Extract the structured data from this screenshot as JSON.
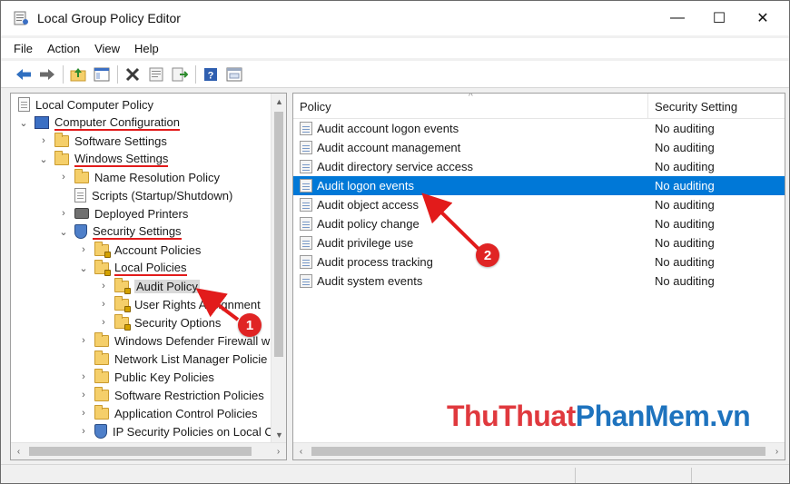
{
  "window": {
    "title": "Local Group Policy Editor",
    "controls": {
      "minimize": "—",
      "maximize": "☐",
      "close": "✕"
    }
  },
  "menu": [
    "File",
    "Action",
    "View",
    "Help"
  ],
  "toolbar": [
    "back-icon",
    "forward-icon",
    "up-folder-icon",
    "show-hide-tree-icon",
    "delete-icon",
    "properties-icon",
    "export-icon",
    "help-icon",
    "view-icon"
  ],
  "tree": {
    "root": "Local Computer Policy",
    "computer_configuration": "Computer Configuration",
    "software_settings": "Software Settings",
    "windows_settings": "Windows Settings",
    "name_resolution_policy": "Name Resolution Policy",
    "scripts": "Scripts (Startup/Shutdown)",
    "deployed_printers": "Deployed Printers",
    "security_settings": "Security Settings",
    "account_policies": "Account Policies",
    "local_policies": "Local Policies",
    "audit_policy": "Audit Policy",
    "user_rights_assignment": "User Rights Assignment",
    "security_options": "Security Options",
    "windows_defender_firewall": "Windows Defender Firewall w",
    "network_list_manager": "Network List Manager Policie",
    "public_key_policies": "Public Key Policies",
    "software_restriction": "Software Restriction Policies",
    "application_control": "Application Control Policies",
    "ip_security": "IP Security Policies on Local C"
  },
  "list": {
    "columns": [
      "Policy",
      "Security Setting"
    ],
    "rows": [
      {
        "policy": "Audit account logon events",
        "setting": "No auditing"
      },
      {
        "policy": "Audit account management",
        "setting": "No auditing"
      },
      {
        "policy": "Audit directory service access",
        "setting": "No auditing"
      },
      {
        "policy": "Audit logon events",
        "setting": "No auditing",
        "selected": true
      },
      {
        "policy": "Audit object access",
        "setting": "No auditing"
      },
      {
        "policy": "Audit policy change",
        "setting": "No auditing"
      },
      {
        "policy": "Audit privilege use",
        "setting": "No auditing"
      },
      {
        "policy": "Audit process tracking",
        "setting": "No auditing"
      },
      {
        "policy": "Audit system events",
        "setting": "No auditing"
      }
    ]
  },
  "callouts": {
    "one": "1",
    "two": "2"
  },
  "watermark": {
    "part1": "ThuThuat",
    "part2": "PhanMem.vn"
  },
  "colors": {
    "selection": "#0078d7",
    "annotation_red": "#e21b1b",
    "watermark_red": "#e0393e",
    "watermark_blue": "#1e73be"
  }
}
